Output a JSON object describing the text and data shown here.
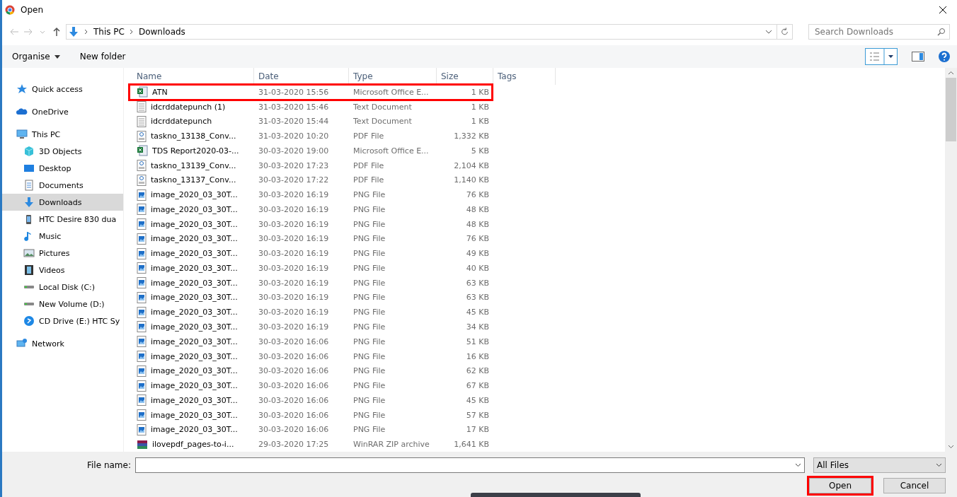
{
  "window": {
    "title": "Open"
  },
  "address": {
    "path": [
      "This PC",
      "Downloads"
    ]
  },
  "search": {
    "placeholder": "Search Downloads"
  },
  "toolbar": {
    "organise": "Organise",
    "new_folder": "New folder"
  },
  "sidebar": {
    "items": [
      {
        "label": "Quick access",
        "kind": "star",
        "selected": false
      },
      {
        "label": "OneDrive",
        "kind": "cloud",
        "selected": false
      },
      {
        "label": "This PC",
        "kind": "pc",
        "selected": false,
        "children": [
          {
            "label": "3D Objects",
            "kind": "cube",
            "selected": false
          },
          {
            "label": "Desktop",
            "kind": "desktop",
            "selected": false
          },
          {
            "label": "Documents",
            "kind": "doc",
            "selected": false
          },
          {
            "label": "Downloads",
            "kind": "download",
            "selected": true
          },
          {
            "label": "HTC Desire 830 dua",
            "kind": "phone",
            "selected": false
          },
          {
            "label": "Music",
            "kind": "music",
            "selected": false
          },
          {
            "label": "Pictures",
            "kind": "pictures",
            "selected": false
          },
          {
            "label": "Videos",
            "kind": "videos",
            "selected": false
          },
          {
            "label": "Local Disk (C:)",
            "kind": "disk",
            "selected": false
          },
          {
            "label": "New Volume (D:)",
            "kind": "disk",
            "selected": false
          },
          {
            "label": "CD Drive (E:) HTC Sy",
            "kind": "cd",
            "selected": false
          }
        ]
      },
      {
        "label": "Network",
        "kind": "network",
        "selected": false
      }
    ]
  },
  "table": {
    "columns": [
      "Name",
      "Date",
      "Type",
      "Size",
      "Tags"
    ],
    "rows": [
      {
        "kind": "excel",
        "name": "ATN",
        "date": "31-03-2020 15:56",
        "type": "Microsoft Office E...",
        "size": "1 KB",
        "highlighted": true
      },
      {
        "kind": "text",
        "name": "idcrddatepunch (1)",
        "date": "31-03-2020 15:46",
        "type": "Text Document",
        "size": "1 KB",
        "highlighted": false
      },
      {
        "kind": "text",
        "name": "idcrddatepunch",
        "date": "31-03-2020 15:44",
        "type": "Text Document",
        "size": "1 KB",
        "highlighted": false
      },
      {
        "kind": "pdf",
        "name": "taskno_13138_Conv...",
        "date": "31-03-2020 10:20",
        "type": "PDF File",
        "size": "1,332 KB",
        "highlighted": false
      },
      {
        "kind": "excel",
        "name": "TDS Report2020-03-...",
        "date": "30-03-2020 19:00",
        "type": "Microsoft Office E...",
        "size": "5 KB",
        "highlighted": false
      },
      {
        "kind": "pdf",
        "name": "taskno_13139_Conv...",
        "date": "30-03-2020 17:23",
        "type": "PDF File",
        "size": "2,104 KB",
        "highlighted": false
      },
      {
        "kind": "pdf",
        "name": "taskno_13137_Conv...",
        "date": "30-03-2020 17:22",
        "type": "PDF File",
        "size": "1,140 KB",
        "highlighted": false
      },
      {
        "kind": "png",
        "name": "image_2020_03_30T...",
        "date": "30-03-2020 16:19",
        "type": "PNG File",
        "size": "76 KB",
        "highlighted": false
      },
      {
        "kind": "png",
        "name": "image_2020_03_30T...",
        "date": "30-03-2020 16:19",
        "type": "PNG File",
        "size": "48 KB",
        "highlighted": false
      },
      {
        "kind": "png",
        "name": "image_2020_03_30T...",
        "date": "30-03-2020 16:19",
        "type": "PNG File",
        "size": "48 KB",
        "highlighted": false
      },
      {
        "kind": "png",
        "name": "image_2020_03_30T...",
        "date": "30-03-2020 16:19",
        "type": "PNG File",
        "size": "76 KB",
        "highlighted": false
      },
      {
        "kind": "png",
        "name": "image_2020_03_30T...",
        "date": "30-03-2020 16:19",
        "type": "PNG File",
        "size": "49 KB",
        "highlighted": false
      },
      {
        "kind": "png",
        "name": "image_2020_03_30T...",
        "date": "30-03-2020 16:19",
        "type": "PNG File",
        "size": "40 KB",
        "highlighted": false
      },
      {
        "kind": "png",
        "name": "image_2020_03_30T...",
        "date": "30-03-2020 16:19",
        "type": "PNG File",
        "size": "63 KB",
        "highlighted": false
      },
      {
        "kind": "png",
        "name": "image_2020_03_30T...",
        "date": "30-03-2020 16:19",
        "type": "PNG File",
        "size": "63 KB",
        "highlighted": false
      },
      {
        "kind": "png",
        "name": "image_2020_03_30T...",
        "date": "30-03-2020 16:19",
        "type": "PNG File",
        "size": "45 KB",
        "highlighted": false
      },
      {
        "kind": "png",
        "name": "image_2020_03_30T...",
        "date": "30-03-2020 16:19",
        "type": "PNG File",
        "size": "34 KB",
        "highlighted": false
      },
      {
        "kind": "png",
        "name": "image_2020_03_30T...",
        "date": "30-03-2020 16:06",
        "type": "PNG File",
        "size": "51 KB",
        "highlighted": false
      },
      {
        "kind": "png",
        "name": "image_2020_03_30T...",
        "date": "30-03-2020 16:06",
        "type": "PNG File",
        "size": "16 KB",
        "highlighted": false
      },
      {
        "kind": "png",
        "name": "image_2020_03_30T...",
        "date": "30-03-2020 16:06",
        "type": "PNG File",
        "size": "62 KB",
        "highlighted": false
      },
      {
        "kind": "png",
        "name": "image_2020_03_30T...",
        "date": "30-03-2020 16:06",
        "type": "PNG File",
        "size": "67 KB",
        "highlighted": false
      },
      {
        "kind": "png",
        "name": "image_2020_03_30T...",
        "date": "30-03-2020 16:06",
        "type": "PNG File",
        "size": "45 KB",
        "highlighted": false
      },
      {
        "kind": "png",
        "name": "image_2020_03_30T...",
        "date": "30-03-2020 16:06",
        "type": "PNG File",
        "size": "57 KB",
        "highlighted": false
      },
      {
        "kind": "png",
        "name": "image_2020_03_30T...",
        "date": "30-03-2020 16:06",
        "type": "PNG File",
        "size": "17 KB",
        "highlighted": false
      },
      {
        "kind": "zip",
        "name": "ilovepdf_pages-to-i...",
        "date": "29-03-2020 17:25",
        "type": "WinRAR ZIP archive",
        "size": "1,641 KB",
        "highlighted": false
      }
    ]
  },
  "file_name": {
    "label": "File name:"
  },
  "file_type": {
    "value": "All Files"
  },
  "buttons": [
    {
      "label": "Open",
      "highlighted": true
    },
    {
      "label": "Cancel",
      "highlighted": false
    }
  ]
}
